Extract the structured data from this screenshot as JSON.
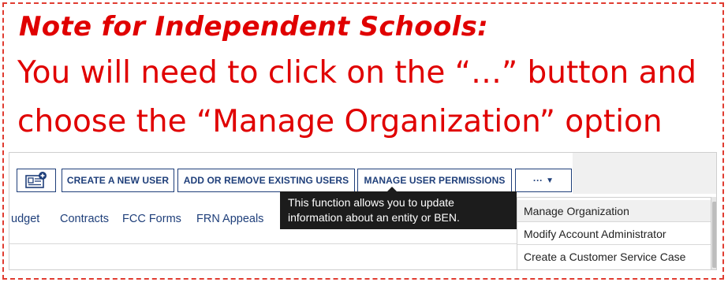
{
  "note": {
    "title": "Note for Independent Schools:",
    "line1": "You will need to click on the “…” button and",
    "line2": "choose the “Manage Organization” option"
  },
  "toolbar": {
    "icon_button": "contact-card-add-icon",
    "create_user": "CREATE A NEW USER",
    "add_remove_users": "ADD OR REMOVE EXISTING USERS",
    "manage_permissions": "MANAGE USER PERMISSIONS",
    "more_label": "···",
    "more_caret": "▼"
  },
  "nav": {
    "items": [
      "udget",
      "Contracts",
      "FCC Forms",
      "FRN Appeals"
    ]
  },
  "tooltip": {
    "text": "This function allows you to update information about an entity or BEN."
  },
  "dropdown": {
    "items": [
      "Manage Organization",
      "Modify Account Administrator",
      "Create a Customer Service Case"
    ]
  },
  "colors": {
    "annotation_red": "#e00000",
    "frame_dashed": "#e03c31",
    "brand_navy": "#1f3f7a",
    "tooltip_bg": "#1c1c1c"
  }
}
